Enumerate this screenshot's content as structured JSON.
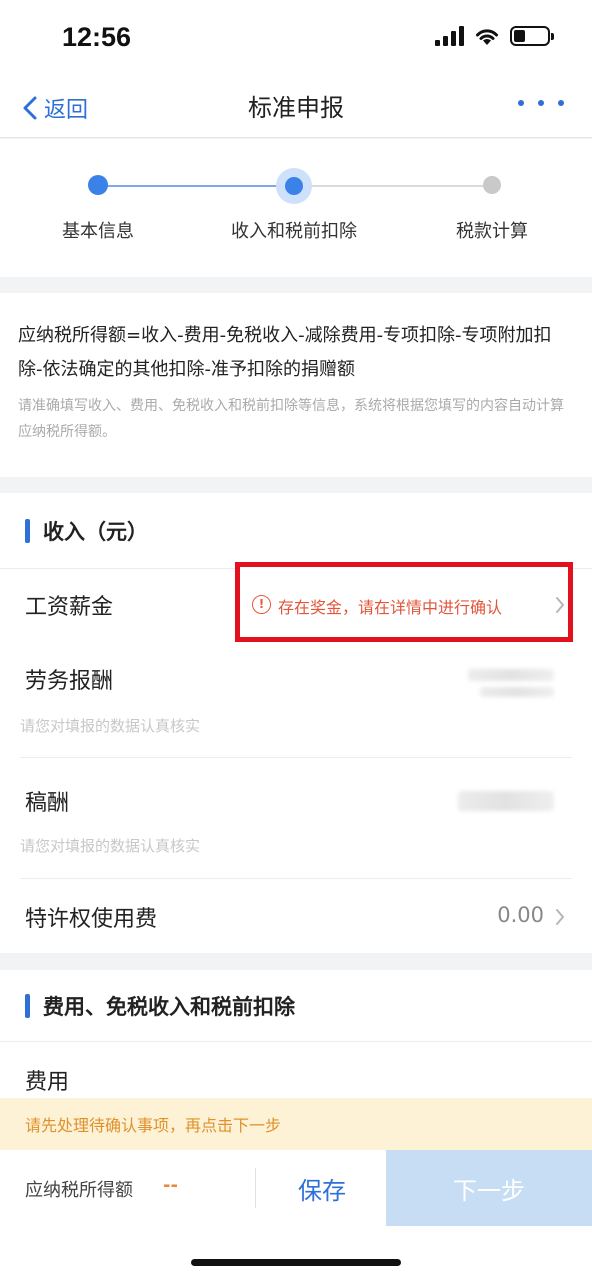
{
  "status_bar": {
    "time": "12:56",
    "battery_level": 0.35
  },
  "nav": {
    "back_label": "返回",
    "title": "标准申报"
  },
  "stepper": {
    "active_color": "#3b82e8",
    "inactive_color": "#c9c9c9",
    "steps": [
      {
        "label": "基本信息",
        "state": "done"
      },
      {
        "label": "收入和税前扣除",
        "state": "current"
      },
      {
        "label": "税款计算",
        "state": "pending"
      }
    ]
  },
  "formula": {
    "text": "应纳税所得额=收入-费用-免税收入-减除费用-专项扣除-专项附加扣除-依法确定的其他扣除-准予扣除的捐赠额",
    "hint": "请准确填写收入、费用、免税收入和税前扣除等信息，系统将根据您填写的内容自动计算应纳税所得额。"
  },
  "income": {
    "title": "收入（元）",
    "rows": [
      {
        "label": "工资薪金",
        "notice": "存在奖金，请在详情中进行确认",
        "notice_color": "#e2553a",
        "highlight_color": "#e3111d"
      },
      {
        "label": "劳务报酬",
        "sub": "请您对填报的数据认真核实"
      },
      {
        "label": "稿酬",
        "sub": "请您对填报的数据认真核实"
      },
      {
        "label": "特许权使用费",
        "value": "0.00"
      }
    ]
  },
  "deduction": {
    "title": "费用、免税收入和税前扣除",
    "rows": [
      {
        "label": "费用"
      }
    ]
  },
  "warning": {
    "text": "请先处理待确认事项，再点击下一步",
    "color": "#e0912c"
  },
  "footer": {
    "taxable_label": "应纳税所得额",
    "taxable_value": "--",
    "save_label": "保存",
    "next_label": "下一步"
  },
  "colors": {
    "brand": "#2e6fd8"
  }
}
